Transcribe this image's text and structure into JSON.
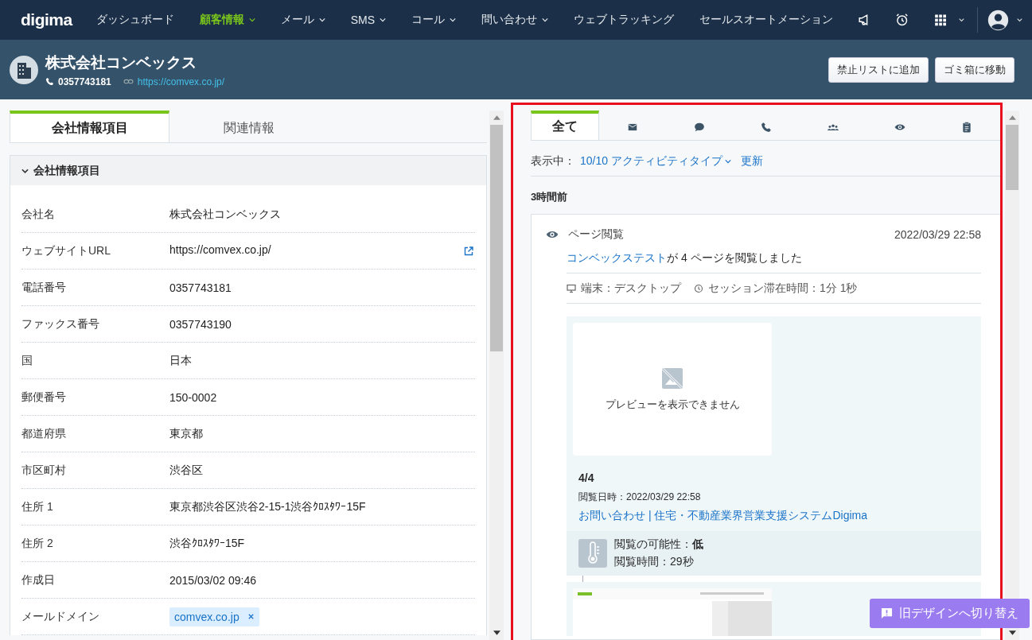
{
  "nav": {
    "logo": "digima",
    "items": [
      {
        "label": "ダッシュボード",
        "selected": false,
        "dropdown": false
      },
      {
        "label": "顧客情報",
        "selected": true,
        "dropdown": true
      },
      {
        "label": "メール",
        "selected": false,
        "dropdown": true
      },
      {
        "label": "SMS",
        "selected": false,
        "dropdown": true
      },
      {
        "label": "コール",
        "selected": false,
        "dropdown": true
      },
      {
        "label": "問い合わせ",
        "selected": false,
        "dropdown": true
      },
      {
        "label": "ウェブトラッキング",
        "selected": false,
        "dropdown": false
      },
      {
        "label": "セールスオートメーション",
        "selected": false,
        "dropdown": false
      }
    ]
  },
  "company": {
    "name": "株式会社コンベックス",
    "phone": "0357743181",
    "url": "https://comvex.co.jp/",
    "buttons": [
      "禁止リストに追加",
      "ゴミ箱に移動"
    ]
  },
  "left_tabs": [
    {
      "label": "会社情報項目",
      "selected": true
    },
    {
      "label": "関連情報",
      "selected": false
    }
  ],
  "section": {
    "title": "会社情報項目",
    "expanded": true,
    "fields": [
      {
        "label": "会社名",
        "value": "株式会社コンベックス",
        "kind": "text"
      },
      {
        "label": "ウェブサイトURL",
        "value": "https://comvex.co.jp/",
        "kind": "url"
      },
      {
        "label": "電話番号",
        "value": "0357743181",
        "kind": "text"
      },
      {
        "label": "ファックス番号",
        "value": "0357743190",
        "kind": "text"
      },
      {
        "label": "国",
        "value": "日本",
        "kind": "text"
      },
      {
        "label": "郵便番号",
        "value": "150-0002",
        "kind": "text"
      },
      {
        "label": "都道府県",
        "value": "東京都",
        "kind": "text"
      },
      {
        "label": "市区町村",
        "value": "渋谷区",
        "kind": "text"
      },
      {
        "label": "住所 1",
        "value": "東京都渋谷区渋谷2-15-1渋谷ｸﾛｽﾀﾜｰ15F",
        "kind": "text"
      },
      {
        "label": "住所 2",
        "value": "渋谷ｸﾛｽﾀﾜｰ15F",
        "kind": "text"
      },
      {
        "label": "作成日",
        "value": "2015/03/02 09:46",
        "kind": "text"
      },
      {
        "label": "メールドメイン",
        "value": "comvex.co.jp",
        "kind": "tag"
      }
    ]
  },
  "activity_tabs": [
    {
      "kind": "text",
      "label": "全て",
      "selected": true
    },
    {
      "kind": "mail",
      "selected": false
    },
    {
      "kind": "chat",
      "selected": false
    },
    {
      "kind": "phone",
      "selected": false
    },
    {
      "kind": "people",
      "selected": false
    },
    {
      "kind": "eye",
      "selected": false
    },
    {
      "kind": "clipboard",
      "selected": false
    }
  ],
  "filter": {
    "prefix": "表示中：",
    "types": "10/10 アクティビティタイプ",
    "refresh": "更新"
  },
  "group_label": "3時間前",
  "activity": {
    "type": "ページ閲覧",
    "time": "2022/03/29 22:58",
    "visitor": "コンベックステスト",
    "summary": "が 4 ページを閲覧しました",
    "device": "端末：デスクトップ",
    "session": "セッション滞在時間：1分 1秒",
    "page": {
      "preview": "プレビューを表示できません",
      "index": "4/4",
      "viewed_at": "閲覧日時：2022/03/29 22:58",
      "title": "お問い合わせ | 住宅・不動産業界営業支援システムDigima",
      "likelihood": "閲覧の可能性：**低**",
      "duration": "閲覧時間：29秒"
    }
  },
  "switch_button": "旧デザインへ切り替え"
}
